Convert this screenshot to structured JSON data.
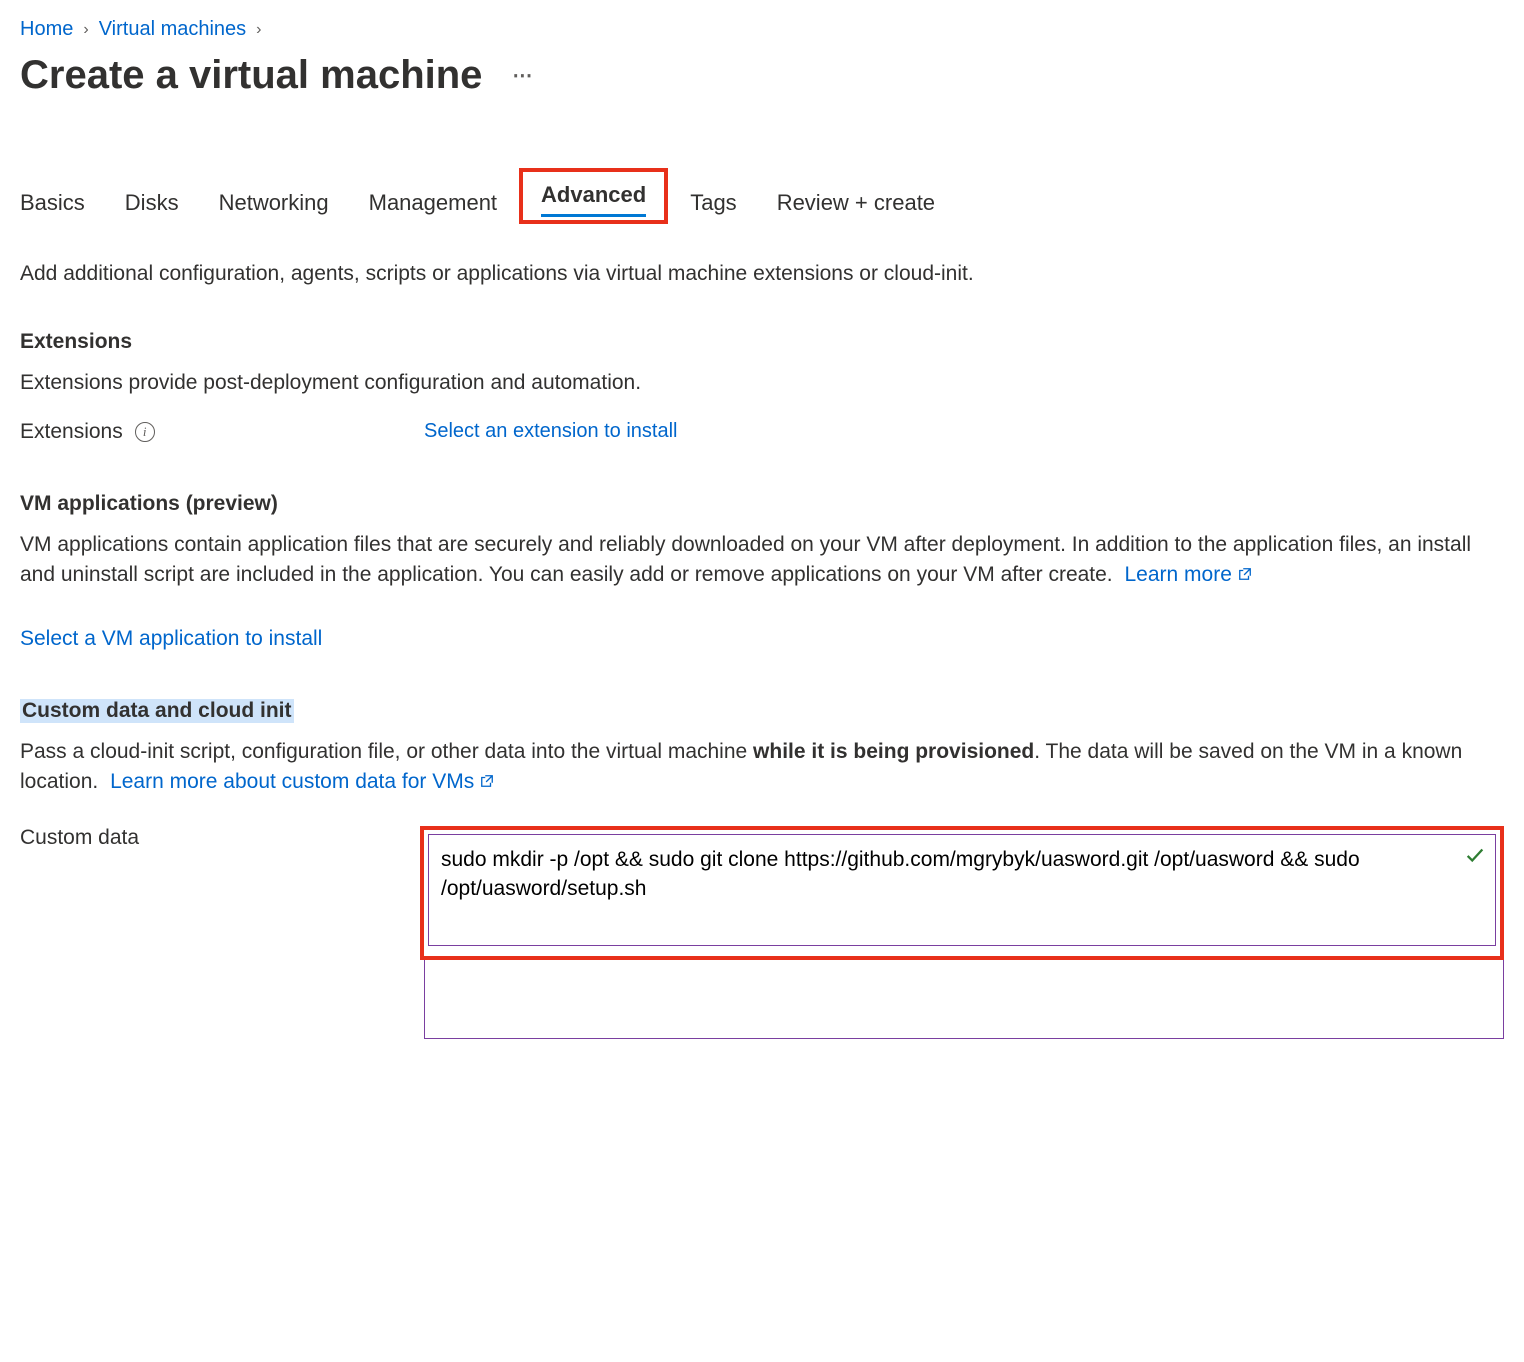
{
  "breadcrumb": {
    "home": "Home",
    "vms": "Virtual machines"
  },
  "page_title": "Create a virtual machine",
  "tabs": {
    "basics": "Basics",
    "disks": "Disks",
    "networking": "Networking",
    "management": "Management",
    "advanced": "Advanced",
    "tags": "Tags",
    "review": "Review + create"
  },
  "intro": "Add additional configuration, agents, scripts or applications via virtual machine extensions or cloud-init.",
  "extensions": {
    "heading": "Extensions",
    "desc": "Extensions provide post-deployment configuration and automation.",
    "label": "Extensions",
    "select_link": "Select an extension to install"
  },
  "vm_apps": {
    "heading": "VM applications (preview)",
    "desc": "VM applications contain application files that are securely and reliably downloaded on your VM after deployment. In addition to the application files, an install and uninstall script are included in the application. You can easily add or remove applications on your VM after create.",
    "learn_more": "Learn more",
    "select_link": "Select a VM application to install"
  },
  "custom_data": {
    "heading": "Custom data and cloud init",
    "desc_pre": "Pass a cloud-init script, configuration file, or other data into the virtual machine ",
    "desc_bold": "while it is being provisioned",
    "desc_post": ". The data will be saved on the VM in a known location.",
    "learn_more": "Learn more about custom data for VMs",
    "label": "Custom data",
    "value": "sudo mkdir -p /opt && sudo git clone https://github.com/mgrybyk/uasword.git /opt/uasword && sudo /opt/uasword/setup.sh"
  }
}
